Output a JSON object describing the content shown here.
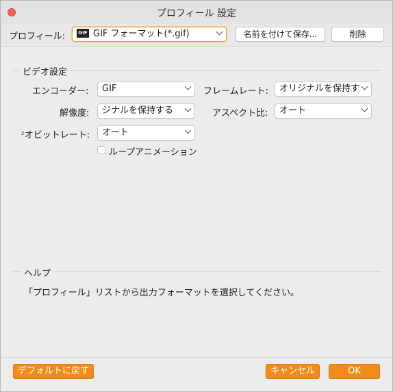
{
  "window": {
    "title": "プロフィール 設定"
  },
  "toolbar": {
    "profile_label": "プロフィール:",
    "profile_value": "GIF フォーマット(*.gif)",
    "profile_icon_text": "GIF",
    "save_as_label": "名前を付けて保存...",
    "delete_label": "削除"
  },
  "video": {
    "section_label": "ビデオ設定",
    "encoder_label": "エンコーダー:",
    "encoder_value": "GIF",
    "framerate_label": "フレームレート:",
    "framerate_value": "オリジナルを保持す",
    "resolution_label": "解像度:",
    "resolution_value": "ジナルを保持する",
    "aspect_label": "アスペクト比:",
    "aspect_value": "オート",
    "bitrate_label": "ᶻオビットレート:",
    "bitrate_value": "オート",
    "loop_label": "ループアニメーション",
    "loop_checked": false
  },
  "help": {
    "section_label": "ヘルプ",
    "text": "「プロフィール」リストから出力フォーマットを選択してください。"
  },
  "footer": {
    "default_label": "デフォルトに戻す",
    "cancel_label": "キャンセル",
    "ok_label": "OK"
  },
  "colors": {
    "accent": "#f08d1a",
    "close": "#fc5f57"
  }
}
